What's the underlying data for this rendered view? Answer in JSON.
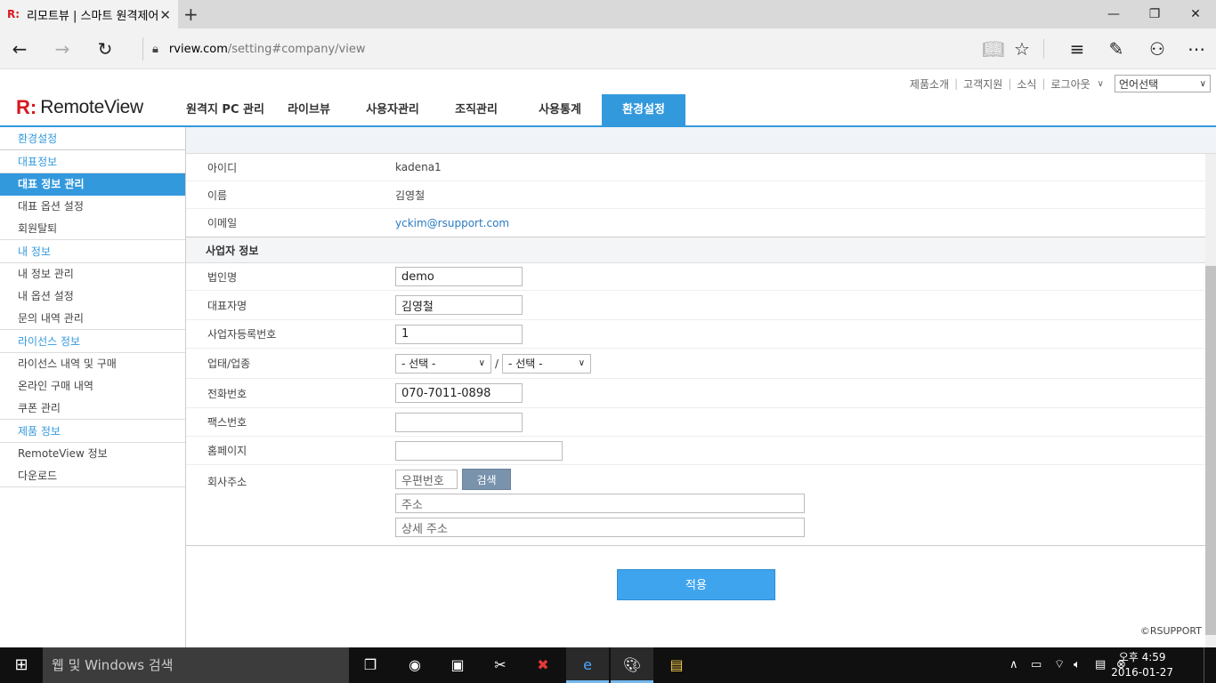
{
  "browser": {
    "tab_title": "리모트뷰 | 스마트 원격제어",
    "favicon": "R:",
    "url_host": "rview.com",
    "url_path": "/setting#company/view"
  },
  "utility": {
    "links": [
      "제품소개",
      "고객지원",
      "소식",
      "로그아웃"
    ],
    "language_select": "언어선택"
  },
  "logo": {
    "mark": "R:",
    "word": "RemoteView"
  },
  "gnb": [
    "원격지 PC 관리",
    "라이브뷰",
    "사용자관리",
    "조직관리",
    "사용통계",
    "환경설정"
  ],
  "sidebar": {
    "title": "환경설정",
    "groups": [
      {
        "head": "대표정보",
        "items": [
          "대표 정보 관리",
          "대표 옵션 설정",
          "회원탈퇴"
        ]
      },
      {
        "head": "내 정보",
        "items": [
          "내 정보 관리",
          "내 옵션 설정",
          "문의 내역 관리"
        ]
      },
      {
        "head": "라이선스 정보",
        "items": [
          "라이선스 내역 및 구매",
          "온라인 구매 내역",
          "쿠폰 관리"
        ]
      },
      {
        "head": "제품 정보",
        "items": [
          "RemoteView 정보",
          "다운로드"
        ]
      }
    ]
  },
  "account": {
    "id_label": "아이디",
    "id_value": "kadena1",
    "name_label": "이름",
    "name_value": "김영철",
    "email_label": "이메일",
    "email_value": "yckim@rsupport.com"
  },
  "business": {
    "section_title": "사업자 정보",
    "corp_label": "법인명",
    "corp_value": "demo",
    "ceo_label": "대표자명",
    "ceo_value": "김영철",
    "regno_label": "사업자등록번호",
    "regno_value": "1",
    "type_label": "업태/업종",
    "type_select_1": "- 선택 -",
    "type_slash": "/",
    "type_select_2": "- 선택 -",
    "phone_label": "전화번호",
    "phone_value": "070-7011-0898",
    "fax_label": "팩스번호",
    "fax_value": "",
    "homepage_label": "홈페이지",
    "homepage_value": "",
    "address_label": "회사주소",
    "zip_placeholder": "우편번호",
    "search_button": "검색",
    "addr_placeholder": "주소",
    "addr_detail_placeholder": "상세 주소"
  },
  "apply_button": "적용",
  "footer": "©RSUPPORT",
  "taskbar": {
    "search_placeholder": "웹 및 Windows 검색",
    "time": "오후 4:59",
    "date": "2016-01-27"
  }
}
